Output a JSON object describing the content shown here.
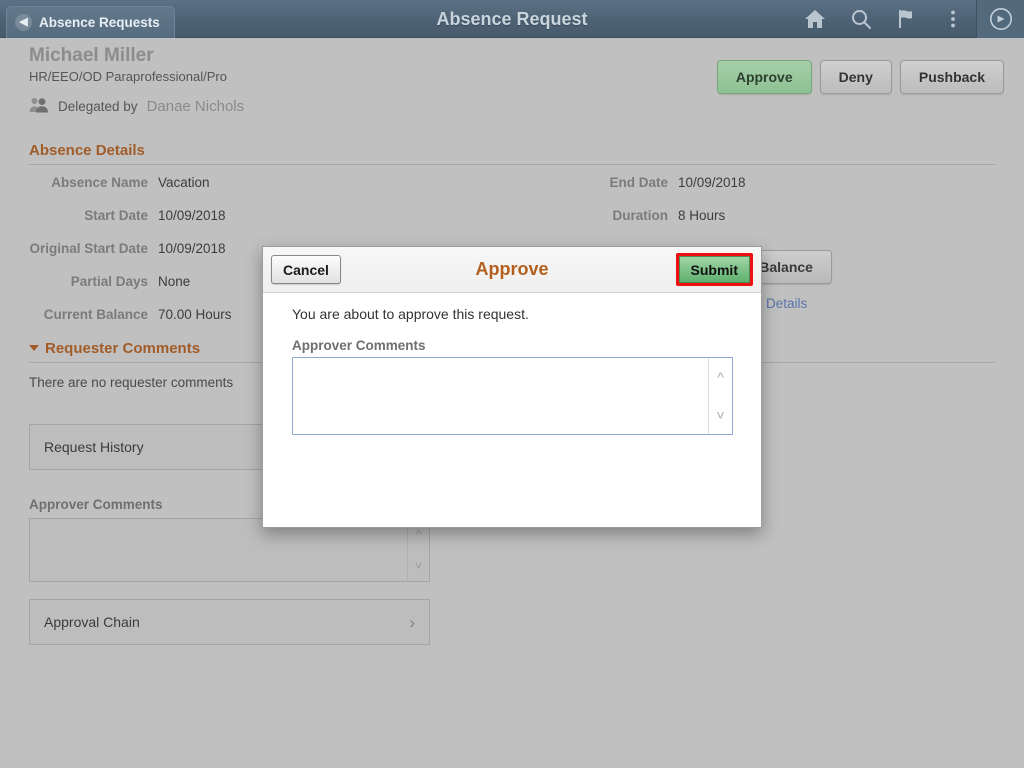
{
  "header": {
    "back_label": "Absence Requests",
    "title": "Absence Request",
    "icons": [
      {
        "name": "home-icon",
        "label": "Home"
      },
      {
        "name": "search-icon",
        "label": "Search"
      },
      {
        "name": "flag-icon",
        "label": "Notifications"
      },
      {
        "name": "kebab-menu-icon",
        "label": "Actions"
      },
      {
        "name": "nav-compass-icon",
        "label": "NavBar"
      }
    ]
  },
  "employee": {
    "name": "Michael Miller",
    "job_title": "HR/EEO/OD Paraprofessional/Pro",
    "delegated_prefix": "Delegated by",
    "delegated_by": "Danae Nichols"
  },
  "actions": {
    "approve": "Approve",
    "deny": "Deny",
    "pushback": "Pushback"
  },
  "absence_details": {
    "section_title": "Absence Details",
    "left_fields": [
      {
        "label": "Absence Name",
        "value": "Vacation"
      },
      {
        "label": "Start Date",
        "value": "10/09/2018"
      },
      {
        "label": "Original Start Date",
        "value": "10/09/2018"
      },
      {
        "label": "Partial Days",
        "value": "None"
      },
      {
        "label": "Current Balance",
        "value": "70.00 Hours"
      }
    ],
    "right_fields": [
      {
        "label": "End Date",
        "value": "10/09/2018"
      },
      {
        "label": "Duration",
        "value": "8 Hours"
      }
    ],
    "balance_button": "Forecast Balance",
    "details_link": "Details"
  },
  "requester_comments": {
    "section_title": "Requester Comments",
    "empty_text": "There are no requester comments"
  },
  "rows": {
    "request_history": "Request History",
    "approval_chain": "Approval Chain"
  },
  "approver_comments_bg": {
    "label": "Approver Comments",
    "value": ""
  },
  "modal": {
    "title": "Approve",
    "cancel": "Cancel",
    "submit": "Submit",
    "message": "You are about to approve this request.",
    "comments_label": "Approver Comments",
    "comments_value": "",
    "comments_placeholder": ""
  },
  "colors": {
    "header_bar": "#4e6275",
    "page_background": "#c0c0c0",
    "section_heading": "#a15c28",
    "approve_green": "#8ec193",
    "submit_highlight": "#ee1111",
    "link_blue": "#5a74a8"
  }
}
